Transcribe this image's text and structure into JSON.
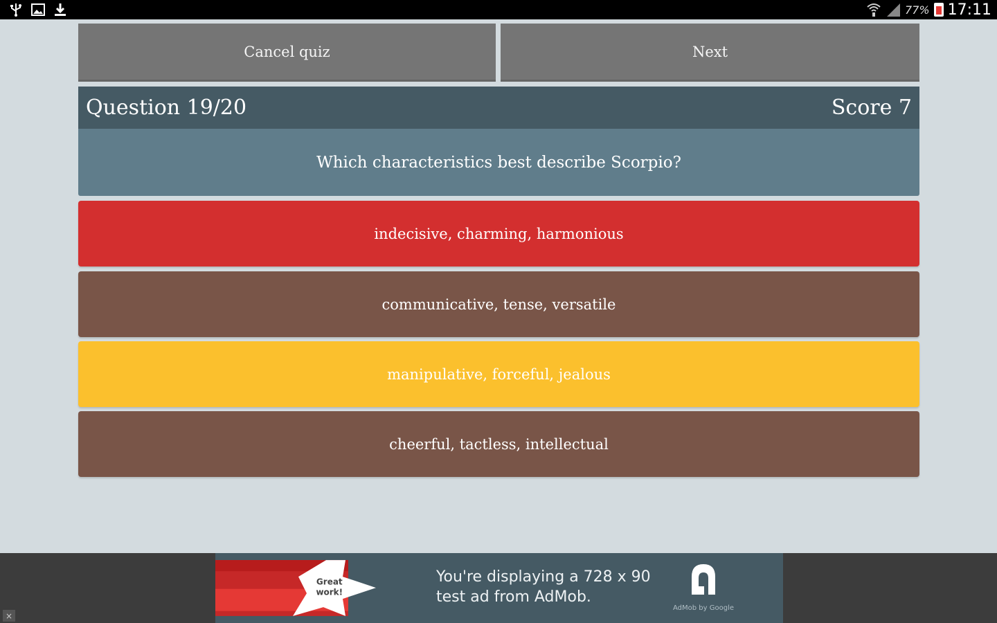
{
  "status_bar": {
    "left_icons": [
      "usb-icon",
      "image-icon",
      "download-icon"
    ],
    "right_icons": [
      "wifi-icon",
      "signal-icon",
      "battery-icon"
    ],
    "battery": "77%",
    "time": "17:11"
  },
  "toolbar": {
    "cancel_label": "Cancel quiz",
    "next_label": "Next"
  },
  "quiz": {
    "question_counter": "Question 19/20",
    "score": "Score 7",
    "question": "Which characteristics best describe Scorpio?",
    "answers": [
      {
        "label": "indecisive, charming, harmonious",
        "color": "#d32f2f"
      },
      {
        "label": "communicative, tense, versatile",
        "color": "#795548"
      },
      {
        "label": "manipulative, forceful, jealous",
        "color": "#fbc02d"
      },
      {
        "label": "cheerful, tactless, intellectual",
        "color": "#795548"
      }
    ]
  },
  "ad": {
    "badge_line1": "Great",
    "badge_line2": "work!",
    "line1": "You're displaying a 728 x 90",
    "line2": "test ad from AdMob.",
    "logo_caption": "AdMob by Google",
    "close_label": "×"
  },
  "colors": {
    "background": "#d3dbdf",
    "button": "#757575",
    "header": "#455a64",
    "question_bg": "#607d8b"
  }
}
